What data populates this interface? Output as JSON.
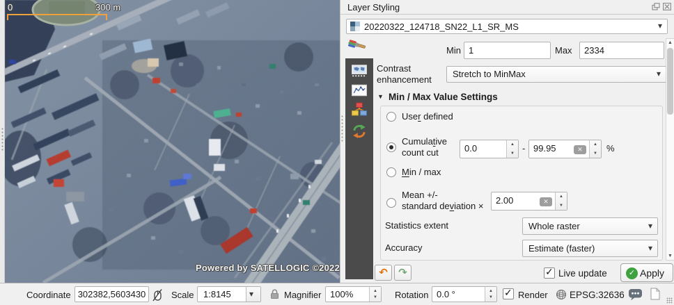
{
  "icons": {
    "collapse": "▼",
    "dropdown": "▾",
    "spin_up": "▲",
    "spin_down": "▼",
    "check": "✓",
    "clear": "✕",
    "undo": "↶",
    "redo": "↷",
    "scroll_up": "▲",
    "scroll_down": "▼"
  },
  "map": {
    "scalebar": {
      "zero": "0",
      "distance": "300 m"
    },
    "watermark": "Powered by SATELLOGIC ©2022"
  },
  "panel": {
    "title": "Layer Styling",
    "layer": {
      "name": "20220322_124718_SN22_L1_SR_MS"
    },
    "minmax": {
      "min_label": "Min",
      "min_value": "1",
      "max_label": "Max",
      "max_value": "2334"
    },
    "contrast": {
      "line1": "Contrast",
      "line2": "enhancement",
      "value": "Stretch to MinMax"
    },
    "section": {
      "title": "Min / Max Value Settings",
      "user_defined": {
        "pre": "Use",
        "mn": "r",
        "post": " defined"
      },
      "cumulative": {
        "l1_pre": "Cumula",
        "l1_mn": "t",
        "l1_post": "ive",
        "l2": "count cut",
        "from": "0.0",
        "dash": "-",
        "to": "99.95",
        "percent": "%"
      },
      "min_max": {
        "mn": "M",
        "post": "in / max"
      },
      "mean_std": {
        "l1": "Mean +/-",
        "l2_pre": "standard de",
        "l2_mn": "v",
        "l2_post": "iation ×",
        "value": "2.00"
      },
      "statistics_extent": {
        "label": "Statistics extent",
        "value": "Whole raster"
      },
      "accuracy": {
        "label": "Accuracy",
        "value": "Estimate (faster)"
      }
    },
    "footer": {
      "live_update": "Live update",
      "apply": "Apply"
    }
  },
  "statusbar": {
    "coordinate": {
      "label": "Coordinate",
      "value": "302382,5603430"
    },
    "scale": {
      "label": "Scale",
      "value": "1:8145"
    },
    "magnifier": {
      "label": "Magnifier",
      "value": "100%"
    },
    "rotation": {
      "label": "Rotation",
      "value": "0.0 °"
    },
    "render_label": "Render",
    "crs": "EPSG:32636"
  }
}
